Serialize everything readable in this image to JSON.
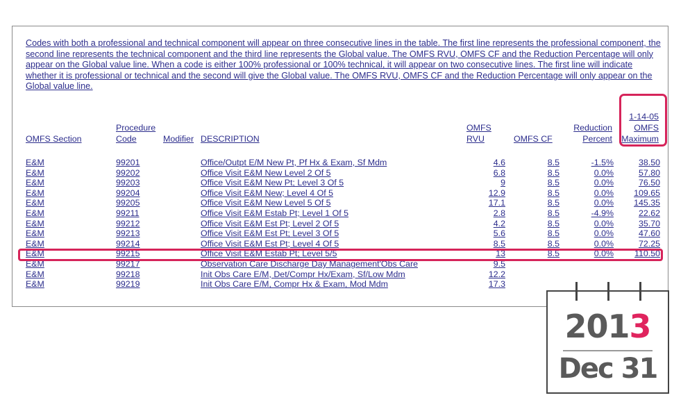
{
  "intro": "Codes with both a professional and technical component will appear on three consecutive lines in the table.  The first line represents the professional component, the second line represents the technical component and the third line represents the Global value.  The OMFS RVU, OMFS CF and the Reduction Percentage will only appear on the Global value line.  When a code is either 100% professional or 100% technical, it will appear on two consecutive lines.  The first line will indicate whether it is professional or technical and the second will give the Global value.  The OMFS RVU, OMFS CF and the Reduction Percentage will only appear on the Global value line.",
  "headers": {
    "section": "OMFS Section",
    "proc1": "Procedure",
    "proc2": "Code",
    "modifier": "Modifier",
    "description": "DESCRIPTION",
    "rvu1": "OMFS",
    "rvu2": "RVU",
    "cf": "OMFS CF",
    "red1": "Reduction",
    "red2": "Percent",
    "max1": "1-14-05",
    "max2": "OMFS",
    "max3": "Maximum"
  },
  "rows": [
    {
      "section": "E&M",
      "code": "99201",
      "description": "Office/Outpt E/M New Pt, Pf Hx & Exam, Sf Mdm",
      "rvu": "4.6",
      "cf": "8.5",
      "reduction": "-1.5%",
      "max": "38.50"
    },
    {
      "section": "E&M",
      "code": "99202",
      "description": "Office Visit E&M New Level 2 Of 5",
      "rvu": "6.8",
      "cf": "8.5",
      "reduction": "0.0%",
      "max": "57.80"
    },
    {
      "section": "E&M",
      "code": "99203",
      "description": "Office Visit E&M New Pt; Level 3 Of 5",
      "rvu": "9",
      "cf": "8.5",
      "reduction": "0.0%",
      "max": "76.50"
    },
    {
      "section": "E&M",
      "code": "99204",
      "description": "Office Visit E&M New; Level 4 Of 5",
      "rvu": "12.9",
      "cf": "8.5",
      "reduction": "0.0%",
      "max": "109.65"
    },
    {
      "section": "E&M",
      "code": "99205",
      "description": "Office Visit E&M New Level 5 Of 5",
      "rvu": "17.1",
      "cf": "8.5",
      "reduction": "0.0%",
      "max": "145.35"
    },
    {
      "section": "E&M",
      "code": "99211",
      "description": "Office Visit E&M Estab Pt; Level 1 Of 5",
      "rvu": "2.8",
      "cf": "8.5",
      "reduction": "-4.9%",
      "max": "22.62"
    },
    {
      "section": "E&M",
      "code": "99212",
      "description": "Office Visit E&M Est Pt; Level 2 Of 5",
      "rvu": "4.2",
      "cf": "8.5",
      "reduction": "0.0%",
      "max": "35.70"
    },
    {
      "section": "E&M",
      "code": "99213",
      "description": "Office Visit E&M Est Pt; Level 3 Of 5",
      "rvu": "5.6",
      "cf": "8.5",
      "reduction": "0.0%",
      "max": "47.60"
    },
    {
      "section": "E&M",
      "code": "99214",
      "description": "Office Visit E&M Est Pt; Level 4 Of 5",
      "rvu": "8.5",
      "cf": "8.5",
      "reduction": "0.0%",
      "max": "72.25"
    },
    {
      "section": "E&M",
      "code": "99215",
      "description": "Office Visit E&M Estab Pt; Level 5/5",
      "rvu": "13",
      "cf": "8.5",
      "reduction": "0.0%",
      "max": "110.50"
    },
    {
      "section": "E&M",
      "code": "99217",
      "description": "Observation Care Discharge Day Management'Obs Care",
      "rvu": "9.5",
      "cf": "",
      "reduction": "",
      "max": ""
    },
    {
      "section": "E&M",
      "code": "99218",
      "description": "Init Obs Care E/M, Det/Compr Hx/Exam, Sf/Low Mdm",
      "rvu": "12.2",
      "cf": "",
      "reduction": "",
      "max": ""
    },
    {
      "section": "E&M",
      "code": "99219",
      "description": "Init Obs Care E/M, Compr Hx & Exam, Mod Mdm",
      "rvu": "17.3",
      "cf": "",
      "reduction": "",
      "max": ""
    }
  ],
  "calendar": {
    "year_main": "201",
    "year_accent": "3",
    "day": "Dec 31",
    "accent_color": "#e0245e"
  },
  "highlight_color": "#d6245a"
}
